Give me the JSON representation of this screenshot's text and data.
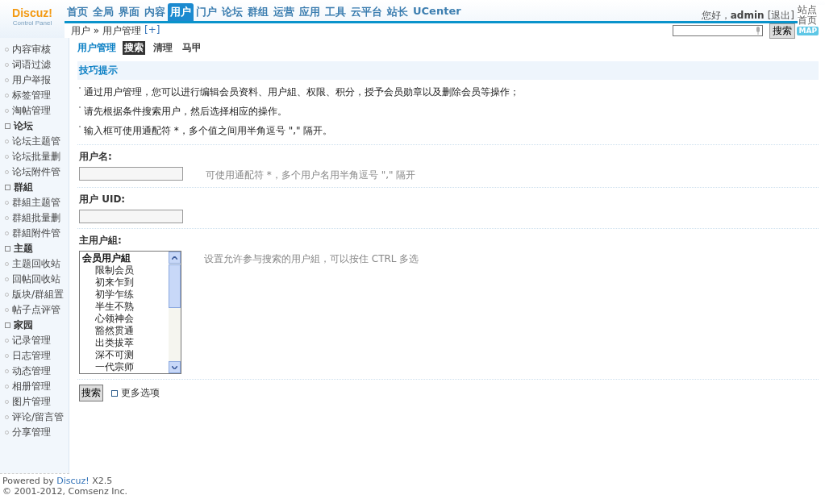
{
  "logo": {
    "name": "Discuz!",
    "subtitle": "Control Panel"
  },
  "nav": [
    {
      "label": "首页",
      "selected": false
    },
    {
      "label": "全局",
      "selected": false
    },
    {
      "label": "界面",
      "selected": false
    },
    {
      "label": "内容",
      "selected": false
    },
    {
      "label": "用户",
      "selected": true
    },
    {
      "label": "门户",
      "selected": false
    },
    {
      "label": "论坛",
      "selected": false
    },
    {
      "label": "群组",
      "selected": false
    },
    {
      "label": "运营",
      "selected": false
    },
    {
      "label": "应用",
      "selected": false
    },
    {
      "label": "工具",
      "selected": false
    },
    {
      "label": "云平台",
      "selected": false
    },
    {
      "label": "站长",
      "selected": false
    },
    {
      "label": "UCenter",
      "selected": false
    }
  ],
  "user_bar": {
    "greeting": "您好，",
    "username": "admin",
    "logout": "[退出]",
    "home": "站点首页",
    "map_badge": "MAP"
  },
  "breadcrumb": {
    "section": "用户",
    "separator": "»",
    "page": "用户管理",
    "add": "[+]"
  },
  "search": {
    "button": "搜索"
  },
  "sidebar": {
    "items": [
      {
        "kind": "item",
        "label": "内容审核"
      },
      {
        "kind": "item",
        "label": "词语过滤"
      },
      {
        "kind": "item",
        "label": "用户举报"
      },
      {
        "kind": "item",
        "label": "标签管理"
      },
      {
        "kind": "item",
        "label": "淘帖管理"
      },
      {
        "kind": "group",
        "label": "论坛"
      },
      {
        "kind": "item",
        "label": "论坛主题管"
      },
      {
        "kind": "item",
        "label": "论坛批量删"
      },
      {
        "kind": "item",
        "label": "论坛附件管"
      },
      {
        "kind": "group",
        "label": "群組"
      },
      {
        "kind": "item",
        "label": "群組主题管"
      },
      {
        "kind": "item",
        "label": "群組批量删"
      },
      {
        "kind": "item",
        "label": "群組附件管"
      },
      {
        "kind": "group",
        "label": "主题"
      },
      {
        "kind": "item",
        "label": "主题回收站"
      },
      {
        "kind": "item",
        "label": "回帖回收站"
      },
      {
        "kind": "item",
        "label": "版块/群組置"
      },
      {
        "kind": "item",
        "label": "帖子点评管"
      },
      {
        "kind": "group",
        "label": "家园"
      },
      {
        "kind": "item",
        "label": "记录管理"
      },
      {
        "kind": "item",
        "label": "日志管理"
      },
      {
        "kind": "item",
        "label": "动态管理"
      },
      {
        "kind": "item",
        "label": "相册管理"
      },
      {
        "kind": "item",
        "label": "图片管理"
      },
      {
        "kind": "item",
        "label": "评论/留言管"
      },
      {
        "kind": "item",
        "label": "分享管理"
      }
    ]
  },
  "footer": {
    "powered": "Powered by",
    "brand": "Discuz!",
    "version": "X2.5",
    "copyright": "© 2001-2012, Comsenz Inc."
  },
  "page_title": "用户管理",
  "subtabs": [
    {
      "label": "搜索",
      "selected": true
    },
    {
      "label": "清理",
      "selected": false
    },
    {
      "label": "马甲",
      "selected": false
    }
  ],
  "tips": {
    "title": "技巧提示",
    "lines": [
      "通过用户管理，您可以进行编辑会员资料、用户組、权限、积分，授予会员勋章以及删除会员等操作；",
      "请先根据条件搜索用户，然后选择相应的操作。",
      "输入框可使用通配符 *，多个值之间用半角逗号 \",\" 隔开。"
    ]
  },
  "fields": [
    {
      "kind": "text",
      "label": "用户名:",
      "hint": "可使用通配符 *，多个用户名用半角逗号 \",\" 隔开"
    },
    {
      "kind": "text",
      "label": "用户 UID:"
    },
    {
      "kind": "list",
      "label": "主用户組:",
      "hint": "设置允许参与搜索的用户組，可以按住 CTRL 多选",
      "options": [
        {
          "kind": "group",
          "label": "会员用户組"
        },
        {
          "kind": "option",
          "label": "限制会员"
        },
        {
          "kind": "option",
          "label": "初来乍到"
        },
        {
          "kind": "option",
          "label": "初学乍练"
        },
        {
          "kind": "option",
          "label": "半生不熟"
        },
        {
          "kind": "option",
          "label": "心领神会"
        },
        {
          "kind": "option",
          "label": "豁然贯通"
        },
        {
          "kind": "option",
          "label": "出类拔萃"
        },
        {
          "kind": "option",
          "label": "深不可测"
        },
        {
          "kind": "option",
          "label": "一代宗师"
        }
      ]
    }
  ],
  "submit": "搜索",
  "more_options": {
    "label": "更多选项",
    "checked": false
  }
}
